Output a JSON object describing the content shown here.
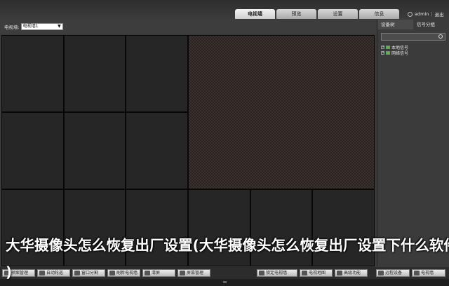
{
  "header": {
    "tabs": [
      {
        "label": "电视墙",
        "active": true
      },
      {
        "label": "预览",
        "active": false
      },
      {
        "label": "设置",
        "active": false
      },
      {
        "label": "信息",
        "active": false
      }
    ],
    "user": "admin",
    "separator": "|",
    "logout_label": "退出"
  },
  "wall": {
    "label": "电视墙:",
    "selected": "电视墙1"
  },
  "side": {
    "tabs": [
      "设备树",
      "信号分组"
    ],
    "tree": [
      "本地信号",
      "网络信号"
    ]
  },
  "toolbar": {
    "left": [
      "预案管理",
      "自动轮巡",
      "窗口分割",
      "刷新电视墙",
      "清屏",
      "屏幕管理"
    ],
    "right": [
      "锁定电视墙",
      "电视地图",
      "高级功能",
      "远程设备",
      "电视墙"
    ]
  },
  "overlay": {
    "line1": "大华摄像头怎么恢复出厂设置(大华摄像头怎么恢复出厂设置下什么软件",
    "line2": ")"
  }
}
